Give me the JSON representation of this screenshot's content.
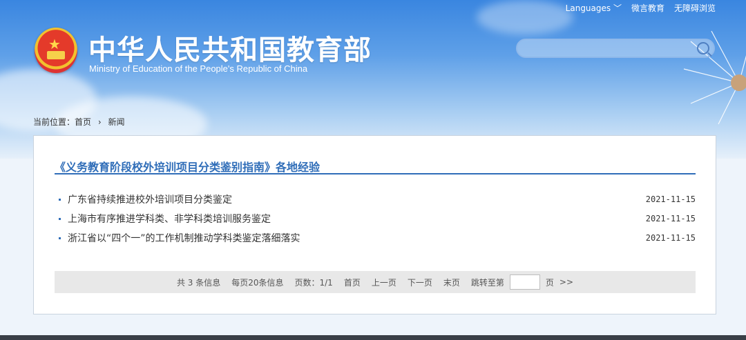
{
  "header": {
    "title_cn": "中华人民共和国教育部",
    "title_en": "Ministry of Education of the People's Republic of China",
    "top_links": [
      "Languages ﹀",
      "微言教育",
      "无障碍浏览"
    ],
    "search": {
      "placeholder": "",
      "value": ""
    }
  },
  "breadcrumb": {
    "label": "当前位置：首页",
    "sep": "›",
    "current": "新闻"
  },
  "box": {
    "title": "《义务教育阶段校外培训项目分类鉴别指南》各地经验",
    "items": [
      {
        "title": "广东省持续推进校外培训项目分类鉴定",
        "date": "2021-11-15"
      },
      {
        "title": "上海市有序推进学科类、非学科类培训服务鉴定",
        "date": "2021-11-15"
      },
      {
        "title": "浙江省以“四个一”的工作机制推动学科类鉴定落细落实",
        "date": "2021-11-15"
      }
    ]
  },
  "pager": {
    "total": "共 3 条信息",
    "per_page": "每页20条信息",
    "pages": "页数：1/1",
    "first": "首页",
    "prev": "上一页",
    "next": "下一页",
    "last": "末页",
    "jump_label": "跳转至第",
    "page_unit": "页",
    "go": ">>"
  }
}
